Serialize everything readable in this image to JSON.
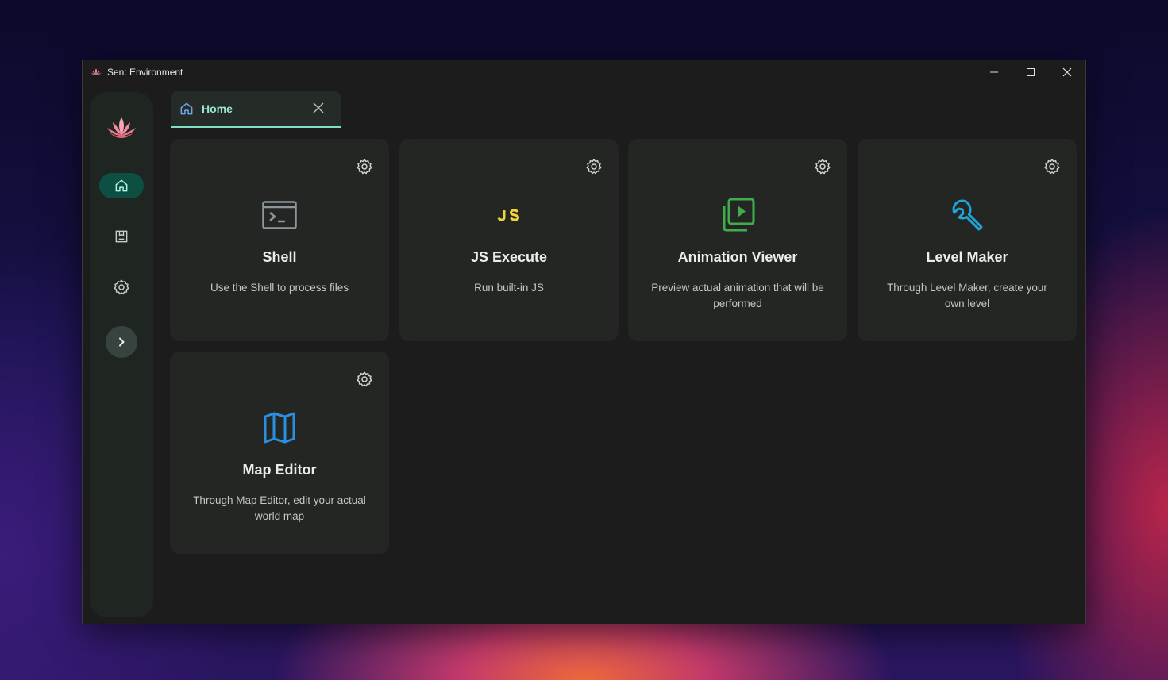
{
  "window": {
    "title": "Sen: Environment"
  },
  "tabs": [
    {
      "label": "Home"
    }
  ],
  "sidebar": {
    "items": [
      {
        "name": "home",
        "active": true
      },
      {
        "name": "saved"
      },
      {
        "name": "settings"
      }
    ]
  },
  "cards": [
    {
      "title": "Shell",
      "description": "Use the Shell to process files",
      "icon": "terminal-icon",
      "icon_color": "#9aa4a6"
    },
    {
      "title": "JS Execute",
      "description": "Run built-in JS",
      "icon": "js-icon",
      "icon_color": "#f0d43a"
    },
    {
      "title": "Animation Viewer",
      "description": "Preview actual animation that will be performed",
      "icon": "play-frames-icon",
      "icon_color": "#3fae4a"
    },
    {
      "title": "Level Maker",
      "description": "Through Level Maker, create your own level",
      "icon": "wrench-icon",
      "icon_color": "#1fa4d9"
    },
    {
      "title": "Map Editor",
      "description": "Through Map Editor, edit your actual world map",
      "icon": "map-icon",
      "icon_color": "#2a8fe0"
    }
  ],
  "colors": {
    "accent": "#7fe0c6",
    "nav_active": "#0e4f44",
    "card_bg": "#232623"
  }
}
